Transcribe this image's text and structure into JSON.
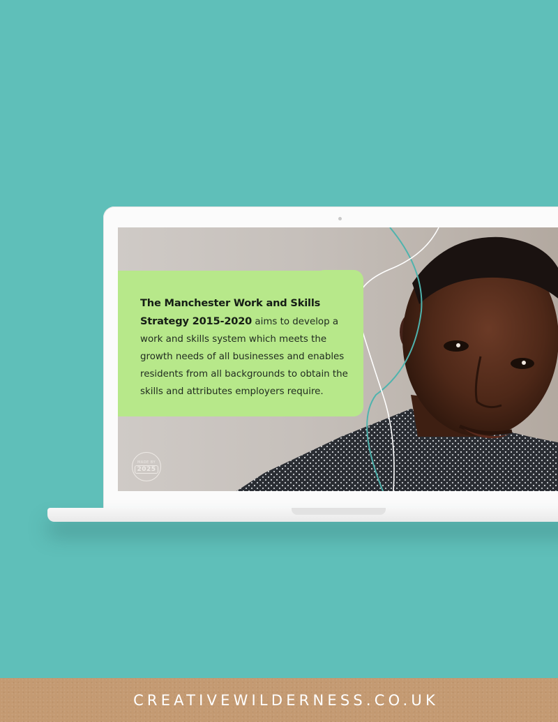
{
  "screen_slide": {
    "headline_bold": "The Manchester Work and Skills Strategy 2015-2020",
    "body_text": " aims to develop a work and skills system which meets the growth needs of all businesses and enables residents from all backgrounds to obtain the skills and attributes employers require.",
    "badge_top_text": "MADE BY",
    "badge_year": "2025",
    "accent_color": "#b7e88a"
  },
  "footer": {
    "site_text": "CREATIVEWILDERNESS.CO.UK",
    "color": "#c49a72"
  },
  "colors": {
    "background": "#5fbfb9",
    "teal_line": "#4fb3ad",
    "white_line": "#ffffff"
  },
  "icons": [
    "webcam-icon",
    "made-by-2025-badge-icon"
  ]
}
